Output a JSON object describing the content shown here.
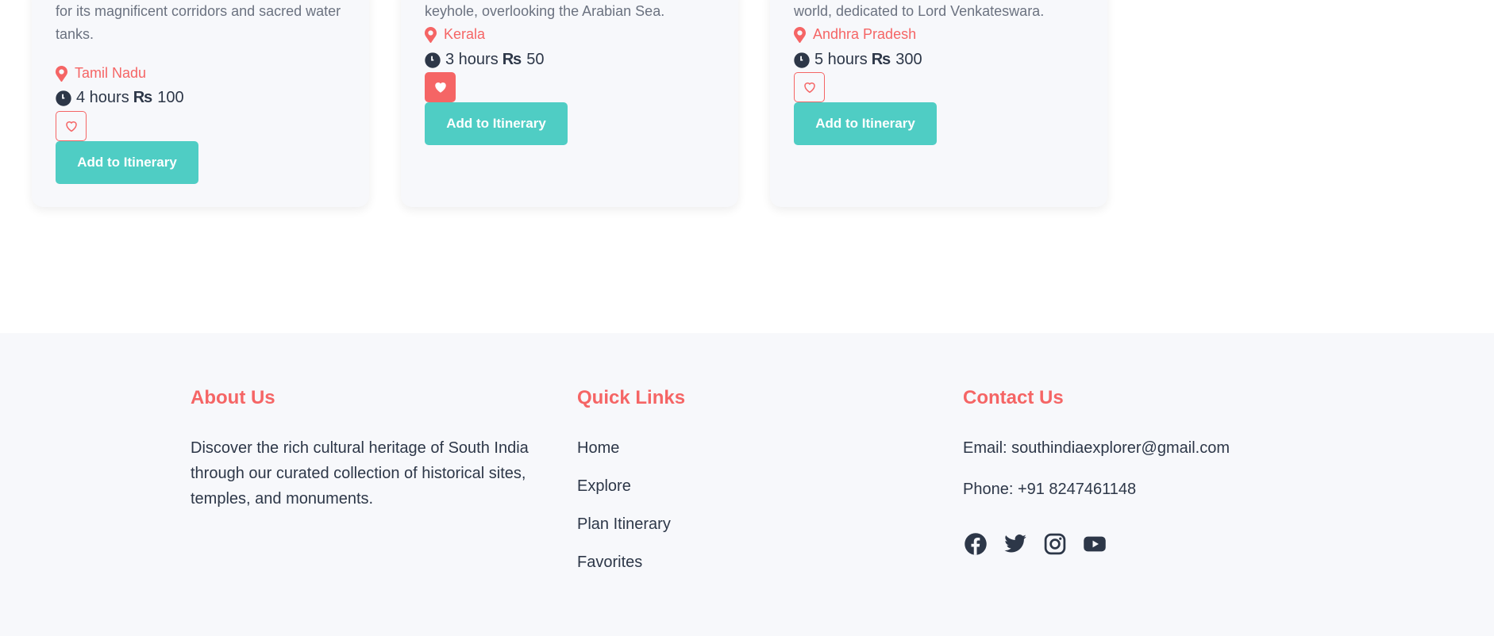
{
  "cards": [
    {
      "description": "for its magnificent corridors and sacred water tanks.",
      "location": "Tamil Nadu",
      "duration": "4 hours",
      "currency_symbol": "₨",
      "price": "100",
      "favorited": false,
      "add_label": "Add to Itinerary"
    },
    {
      "description": "keyhole, overlooking the Arabian Sea.",
      "location": "Kerala",
      "duration": "3 hours",
      "currency_symbol": "₨",
      "price": "50",
      "favorited": true,
      "add_label": "Add to Itinerary"
    },
    {
      "description": "world, dedicated to Lord Venkateswara.",
      "location": "Andhra Pradesh",
      "duration": "5 hours",
      "currency_symbol": "₨",
      "price": "300",
      "favorited": false,
      "add_label": "Add to Itinerary"
    }
  ],
  "footer": {
    "about": {
      "heading": "About Us",
      "text": "Discover the rich cultural heritage of South India through our curated collection of historical sites, temples, and monuments."
    },
    "quick_links": {
      "heading": "Quick Links",
      "items": [
        "Home",
        "Explore",
        "Plan Itinerary",
        "Favorites"
      ]
    },
    "contact": {
      "heading": "Contact Us",
      "email": "Email: southindiaexplorer@gmail.com",
      "phone": "Phone: +91 8247461148",
      "social": [
        "facebook-icon",
        "twitter-icon",
        "instagram-icon",
        "youtube-icon"
      ]
    }
  },
  "colors": {
    "accent": "#f56565",
    "teal": "#4fcdc4",
    "text": "#2d3748",
    "muted": "#6b7280",
    "footer_bg": "#f7f8fb"
  }
}
